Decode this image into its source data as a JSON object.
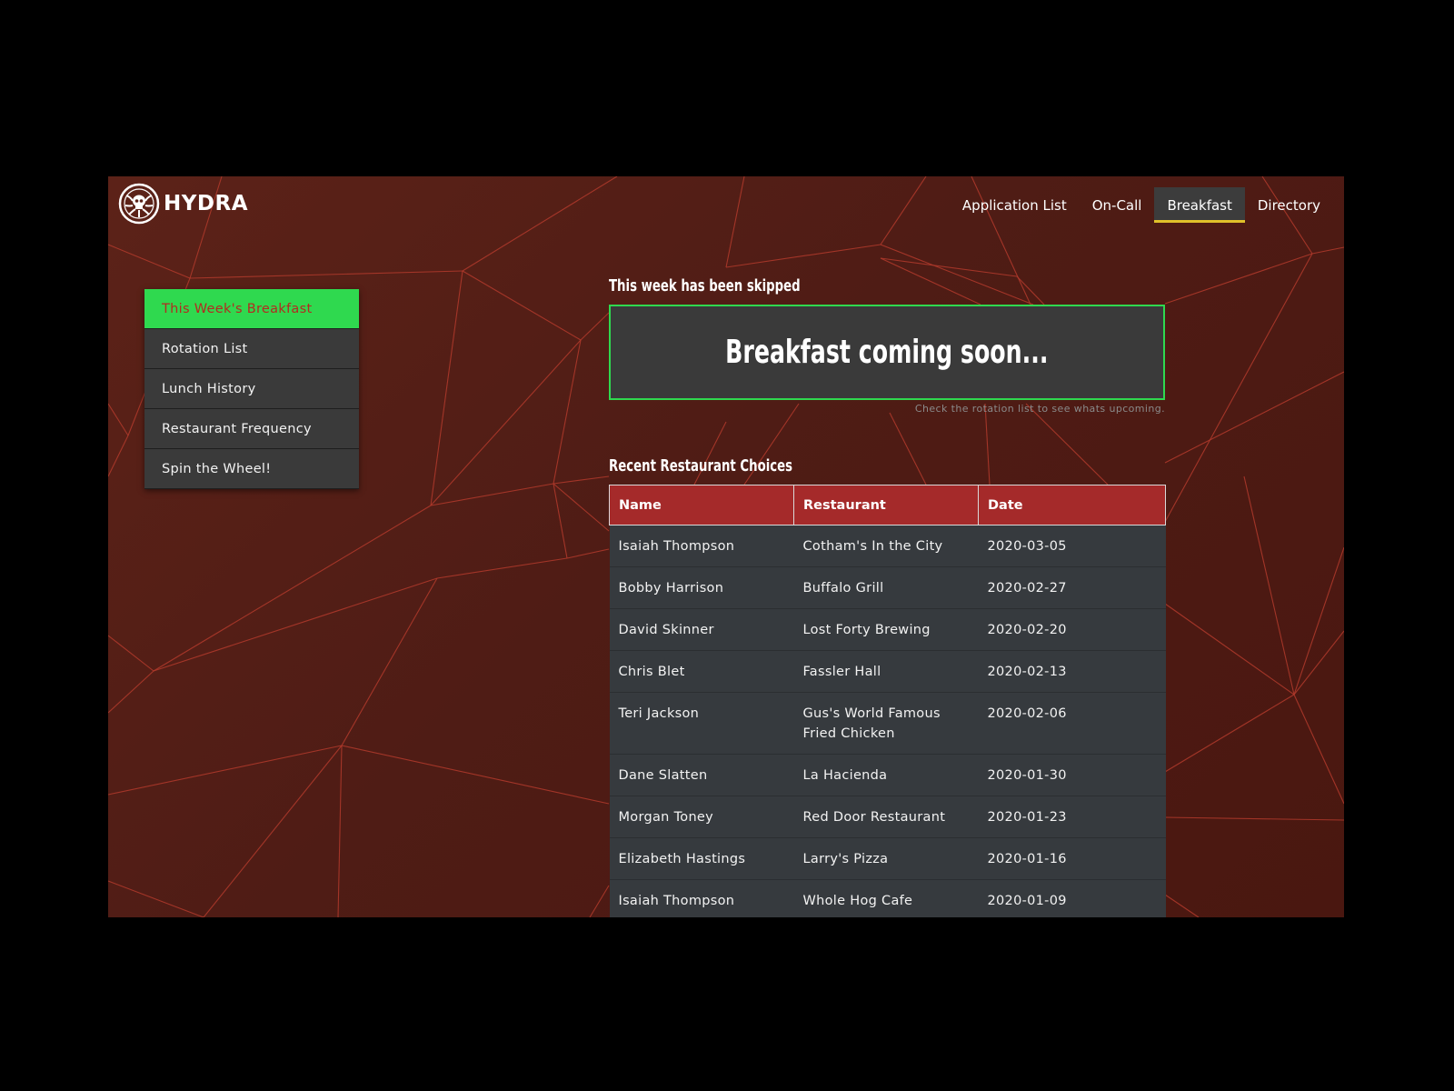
{
  "brand": {
    "name": "HYDRA",
    "logo_icon": "hydra-skull-icon"
  },
  "topnav": {
    "items": [
      {
        "label": "Application List",
        "active": false
      },
      {
        "label": "On-Call",
        "active": false
      },
      {
        "label": "Breakfast",
        "active": true
      },
      {
        "label": "Directory",
        "active": false
      }
    ]
  },
  "sidebar": {
    "items": [
      {
        "label": "This Week's Breakfast",
        "active": true
      },
      {
        "label": "Rotation List",
        "active": false
      },
      {
        "label": "Lunch History",
        "active": false
      },
      {
        "label": "Restaurant Frequency",
        "active": false
      },
      {
        "label": "Spin the Wheel!",
        "active": false
      }
    ]
  },
  "main": {
    "status_heading": "This week has been skipped",
    "breakfast_message": "Breakfast coming soon...",
    "hint": "Check the rotation list to see whats upcoming.",
    "recent_heading": "Recent Restaurant Choices",
    "table": {
      "columns": [
        "Name",
        "Restaurant",
        "Date"
      ],
      "rows": [
        [
          "Isaiah Thompson",
          "Cotham's In the City",
          "2020-03-05"
        ],
        [
          "Bobby Harrison",
          "Buffalo Grill",
          "2020-02-27"
        ],
        [
          "David Skinner",
          "Lost Forty Brewing",
          "2020-02-20"
        ],
        [
          "Chris Blet",
          "Fassler Hall",
          "2020-02-13"
        ],
        [
          "Teri Jackson",
          "Gus's World Famous Fried Chicken",
          "2020-02-06"
        ],
        [
          "Dane Slatten",
          "La Hacienda",
          "2020-01-30"
        ],
        [
          "Morgan Toney",
          "Red Door Restaurant",
          "2020-01-23"
        ],
        [
          "Elizabeth Hastings",
          "Larry's Pizza",
          "2020-01-16"
        ],
        [
          "Isaiah Thompson",
          "Whole Hog Cafe",
          "2020-01-09"
        ]
      ]
    }
  },
  "colors": {
    "accent_green": "#2fd94f",
    "header_red": "#a52a2a",
    "active_underline": "#e0c12a",
    "background": "#521d15"
  }
}
